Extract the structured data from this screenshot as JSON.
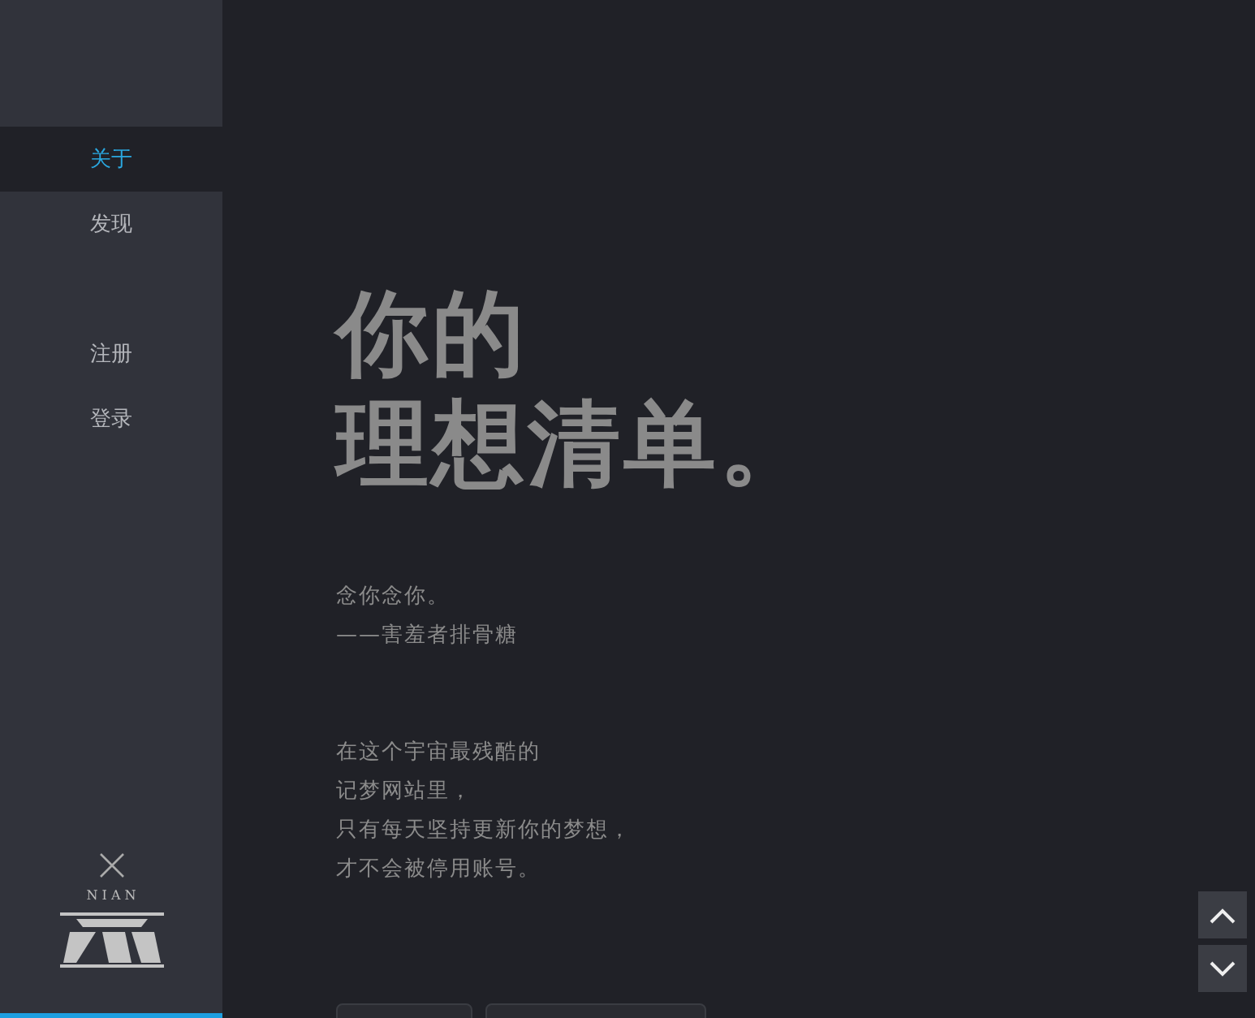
{
  "sidebar": {
    "nav_items": [
      {
        "label": "关于",
        "selected": true
      },
      {
        "label": "发现",
        "selected": false
      }
    ],
    "account_items": [
      {
        "label": "注册",
        "selected": false
      },
      {
        "label": "登录",
        "selected": false
      }
    ],
    "logo_text": "N I A N"
  },
  "main": {
    "headline": [
      "你的",
      "理想清单。"
    ],
    "quote": [
      "念你念你。",
      "——害羞者排骨糖"
    ],
    "paragraph": [
      "在这个宇宙最残酷的",
      "记梦网站里，",
      "只有每天坚持更新你的梦想，",
      "才不会被停用账号。"
    ]
  }
}
